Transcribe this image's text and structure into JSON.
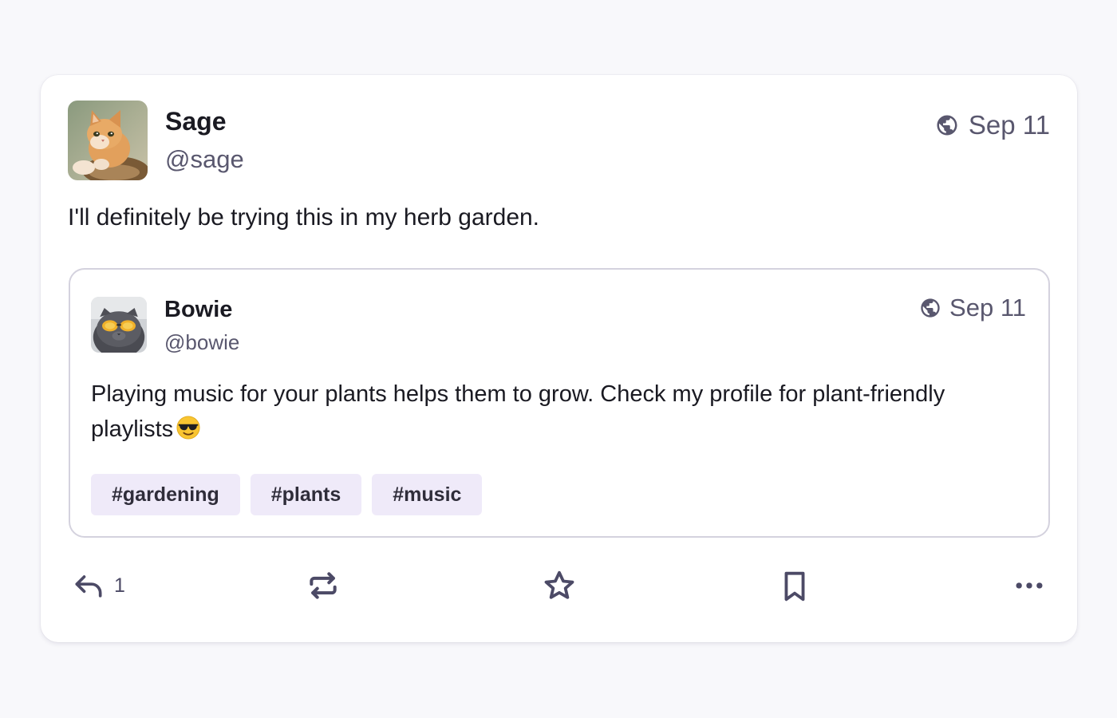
{
  "post": {
    "author": {
      "display_name": "Sage",
      "handle": "@sage",
      "avatar": "cat-avatar"
    },
    "date": "Sep 11",
    "visibility_icon": "globe-icon",
    "text": "I'll definitely be trying this in my herb garden.",
    "quoted": {
      "author": {
        "display_name": "Bowie",
        "handle": "@bowie",
        "avatar": "cat-with-sunglasses-avatar"
      },
      "date": "Sep 11",
      "visibility_icon": "globe-icon",
      "text": "Playing music for your plants helps them to grow. Check my profile for plant-friendly playlists",
      "emoji": "smiling-face-with-sunglasses",
      "hashtags": [
        "#gardening",
        "#plants",
        "#music"
      ]
    },
    "actions": {
      "reply": {
        "icon": "reply-icon",
        "count": "1"
      },
      "boost": {
        "icon": "boost-icon"
      },
      "favourite": {
        "icon": "star-icon"
      },
      "bookmark": {
        "icon": "bookmark-icon"
      },
      "more": {
        "icon": "more-icon"
      }
    }
  },
  "colors": {
    "page_background": "#f8f8fb",
    "card_background": "#ffffff",
    "text_primary": "#1a1a22",
    "text_secondary": "#59576e",
    "icon": "#4c4a66",
    "hashtag_background": "#efeaf9",
    "quote_border": "#d4d2de"
  }
}
